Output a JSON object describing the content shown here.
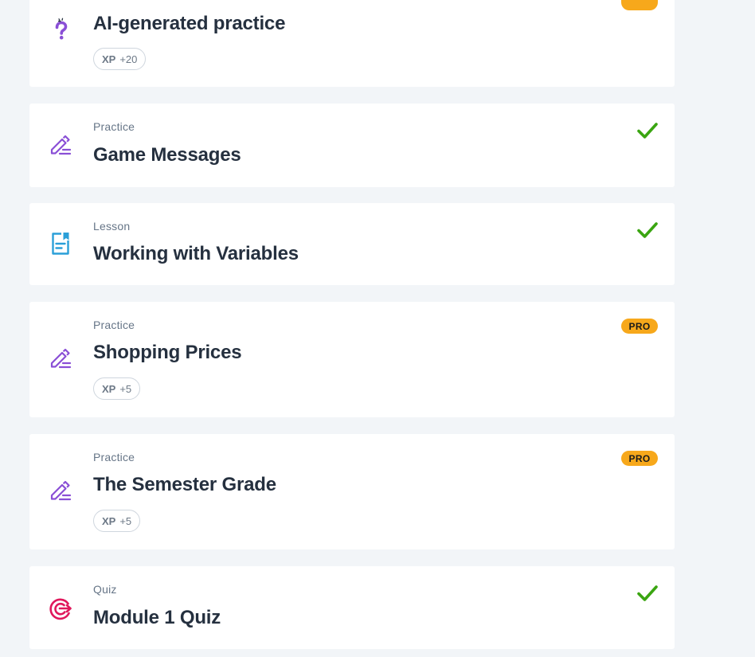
{
  "items": [
    {
      "kind": "ai-practice",
      "type": "",
      "title": "AI-generated practice",
      "xp_label": "XP",
      "xp_value": "+20",
      "status": "pro-partial",
      "icon": "question-sparkle-icon",
      "icon_color": "#8a4fd6"
    },
    {
      "kind": "practice",
      "type": "Practice",
      "title": "Game Messages",
      "status": "completed",
      "icon": "pencil-edit-icon",
      "icon_color": "#8a4fd6"
    },
    {
      "kind": "lesson",
      "type": "Lesson",
      "title": "Working with Variables",
      "status": "completed",
      "icon": "document-bookmark-icon",
      "icon_color": "#2a9fd8"
    },
    {
      "kind": "practice",
      "type": "Practice",
      "title": "Shopping Prices",
      "xp_label": "XP",
      "xp_value": "+5",
      "pro_label": "PRO",
      "status": "pro",
      "icon": "pencil-edit-icon",
      "icon_color": "#8a4fd6"
    },
    {
      "kind": "practice",
      "type": "Practice",
      "title": "The Semester Grade",
      "xp_label": "XP",
      "xp_value": "+5",
      "pro_label": "PRO",
      "status": "pro",
      "icon": "pencil-edit-icon",
      "icon_color": "#8a4fd6"
    },
    {
      "kind": "quiz",
      "type": "Quiz",
      "title": "Module 1 Quiz",
      "status": "completed",
      "icon": "target-icon",
      "icon_color": "#e0185c"
    }
  ],
  "colors": {
    "background": "#f2f5f8",
    "card": "#ffffff",
    "check": "#3aa511",
    "pro_badge": "#f7a81b",
    "title_text": "#25303f",
    "type_text": "#667587"
  }
}
